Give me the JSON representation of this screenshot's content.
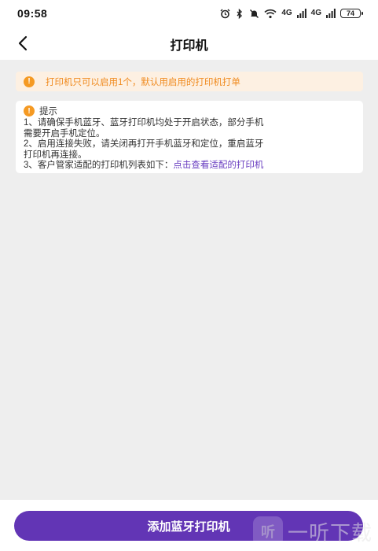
{
  "status_bar": {
    "time": "09:58",
    "signal_1": "4G",
    "signal_2": "4G",
    "battery": "74"
  },
  "header": {
    "title": "打印机"
  },
  "notice": {
    "text": "打印机只可以启用1个，默认用启用的打印机打单",
    "icon": "warning-icon",
    "color": "#f08a1e"
  },
  "tips": {
    "title": "提示",
    "line1a": "1、请确保手机蓝牙、蓝牙打印机均处于开启状态，部分手机",
    "line1b": "需要开启手机定位。",
    "line2a": "2、启用连接失败，请关闭再打开手机蓝牙和定位，重启蓝牙",
    "line2b": "打印机再连接。",
    "line3_prefix": "3、客户管家适配的打印机列表如下：",
    "line3_link": "点击查看适配的打印机"
  },
  "footer": {
    "add_button": "添加蓝牙打印机",
    "accent": "#6235b5"
  },
  "watermark": {
    "logo": "听",
    "text": "一听下载"
  }
}
